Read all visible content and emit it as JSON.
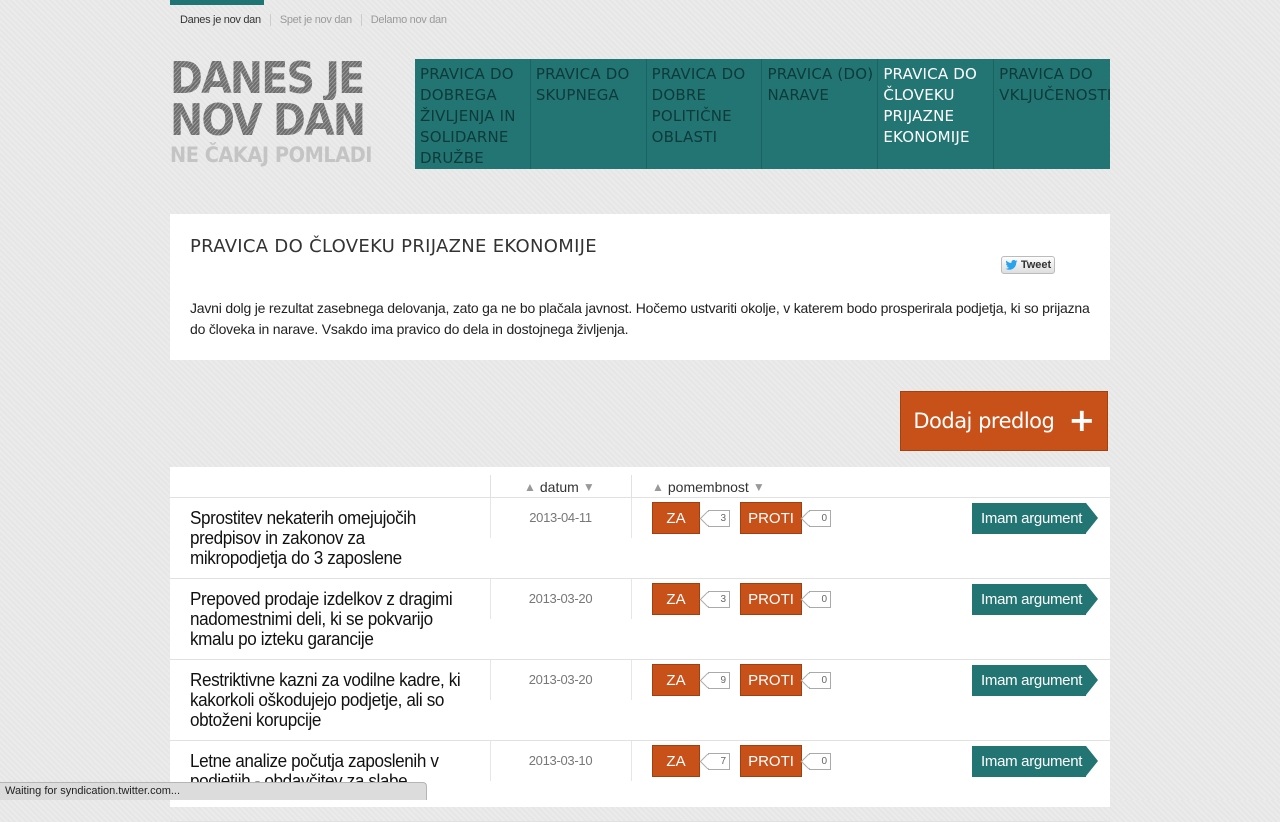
{
  "topnav": {
    "links": [
      "Danes je nov dan",
      "Spet je nov dan",
      "Delamo nov dan"
    ]
  },
  "logo": {
    "line1": "DANES JE",
    "line2": "NOV DAN",
    "line3": "NE ČAKAJ POMLADI"
  },
  "categories": [
    "PRAVICA DO DOBREGA ŽIVLJENJA IN SOLIDARNE DRUŽBE",
    "PRAVICA DO SKUPNEGA",
    "PRAVICA DO DOBRE POLITIČNE OBLASTI",
    "PRAVICA (DO) NARAVE",
    "PRAVICA DO ČLOVEKU PRIJAZNE EKONOMIJE",
    "PRAVICA DO VKLJUČENOSTI"
  ],
  "panel": {
    "title": "PRAVICA DO ČLOVEKU PRIJAZNE EKONOMIJE",
    "tweet": "Tweet",
    "text": "Javni dolg je rezultat zasebnega delovanja, zato ga ne bo plačala javnost. Hočemo ustvariti okolje, v katerem bodo prosperirala podjetja, ki so prijazna do človeka in narave. Vsakdo ima pravico do dela in dostojnega življenja."
  },
  "add_button": {
    "label": "Dodaj predlog",
    "icon": "+"
  },
  "table": {
    "col_date": "datum",
    "col_importance": "pomembnost",
    "za_label": "ZA",
    "proti_label": "PROTI",
    "arg_label": "Imam argument",
    "rows": [
      {
        "title": "Sprostitev nekaterih omejujočih predpisov in zakonov za mikropodjetja do 3 zaposlene",
        "date": "2013-04-11",
        "za": "3",
        "proti": "0"
      },
      {
        "title": "Prepoved prodaje izdelkov z dragimi nadomestnimi deli, ki se pokvarijo kmalu po izteku garancije",
        "date": "2013-03-20",
        "za": "3",
        "proti": "0"
      },
      {
        "title": "Restriktivne kazni za vodilne kadre, ki kakorkoli oškodujejo podjetje, ali so obtoženi korupcije",
        "date": "2013-03-20",
        "za": "9",
        "proti": "0"
      },
      {
        "title": "Letne analize počutja zaposlenih v podjetjih - obdavčitev za slabe",
        "date": "2013-03-10",
        "za": "7",
        "proti": "0"
      }
    ]
  },
  "status": "Waiting for syndication.twitter.com...",
  "colors": {
    "teal": "#237574",
    "orange": "#c8511a"
  }
}
